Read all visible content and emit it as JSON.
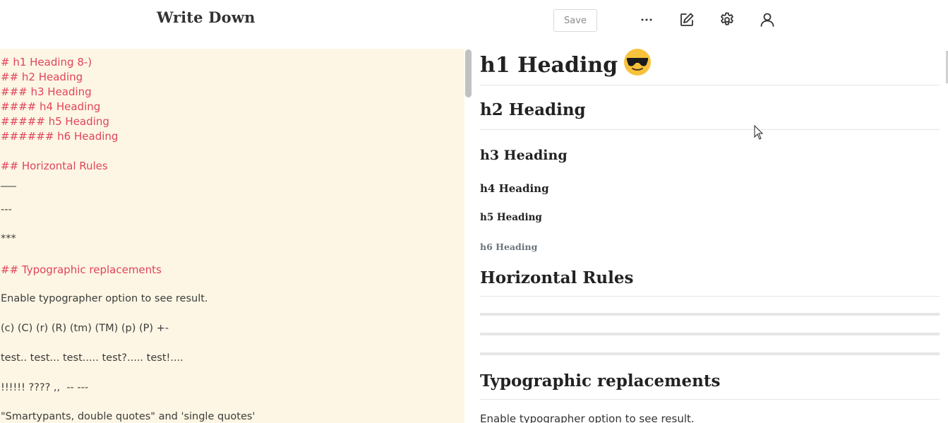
{
  "header": {
    "app_title": "Write Down",
    "save_label": "Save",
    "icons": [
      "more-icon",
      "edit-icon",
      "gear-icon",
      "user-icon"
    ]
  },
  "editor": {
    "lines": [
      "# h1 Heading 8-)",
      "## h2 Heading",
      "### h3 Heading",
      "#### h4 Heading",
      "##### h5 Heading",
      "###### h6 Heading",
      "## Horizontal Rules",
      "___",
      "---",
      "***",
      "## Typographic replacements",
      "Enable typographer option to see result.",
      "(c) (C) (r) (R) (tm) (TM) (p) (P) +-",
      "test.. test... test..... test?..... test!....",
      "!!!!!! ???? ,,  -- ---",
      "\"Smartypants, double quotes\" and 'single quotes'"
    ],
    "background": "#fdf6e4",
    "heading_color": "#e0445a"
  },
  "preview": {
    "h1": "h1 Heading",
    "h2": "h2 Heading",
    "h3": "h3 Heading",
    "h4": "h4 Heading",
    "h5": "h5 Heading",
    "h6": "h6 Heading",
    "horizontal_rules": "Horizontal Rules",
    "typographic": "Typographic replacements",
    "typographic_text": "Enable typographer option to see result."
  }
}
